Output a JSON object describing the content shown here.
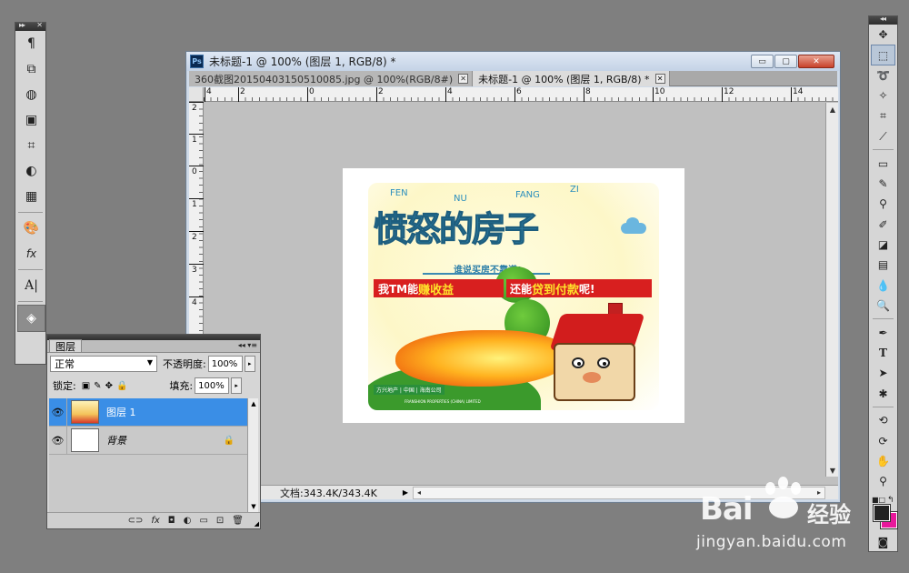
{
  "document": {
    "title": "未标题-1 @ 100% (图层 1, RGB/8) *",
    "app_badge": "Ps",
    "tabs": [
      {
        "label": "360截图20150403150510085.jpg @ 100%(RGB/8#)",
        "close": "✕"
      },
      {
        "label": "未标题-1 @ 100% (图层 1, RGB/8) *",
        "close": "✕"
      }
    ],
    "window_buttons": {
      "minimize": "▭",
      "maximize": "▢",
      "close": "✕"
    },
    "ruler_h": [
      "4",
      "2",
      "0",
      "2",
      "4",
      "6",
      "8",
      "10",
      "12",
      "14"
    ],
    "ruler_v": [
      "2",
      "1",
      "0",
      "1",
      "2",
      "3",
      "4"
    ],
    "status": "文档:343.4K/343.4K"
  },
  "poster": {
    "pinyin": [
      "FEN",
      "NU",
      "FANG",
      "ZI"
    ],
    "title": "愤怒的房子",
    "subtitle": "谁说买房不靠谱!",
    "banner1_a": "我TM能",
    "banner1_b": "赚收益",
    "banner2_a": "还能",
    "banner2_b": "贷到付款",
    "banner2_c": "呢!",
    "logo": "方兴地产 | 中国 | 海南公司",
    "logo_small": "FRANSHION PROPERTIES (CHINA) LIMITED"
  },
  "layers_panel": {
    "tab": "图层",
    "blend_mode": "正常",
    "opacity_label": "不透明度:",
    "opacity_value": "100%",
    "lock_label": "锁定:",
    "fill_label": "填充:",
    "fill_value": "100%",
    "layers": [
      {
        "name": "图层 1",
        "selected": true
      },
      {
        "name": "背景",
        "selected": false,
        "locked": true
      }
    ],
    "bottom_icons": [
      "link-icon",
      "fx-icon",
      "mask-icon",
      "adjustment-icon",
      "group-icon",
      "new-layer-icon",
      "trash-icon"
    ]
  },
  "watermark": {
    "brand_a": "Bai",
    "brand_b": "经验",
    "url": "jingyan.baidu.com"
  },
  "colors": {
    "foreground": "#222222",
    "background": "#e8179b",
    "selected_layer": "#3a8ee6"
  }
}
